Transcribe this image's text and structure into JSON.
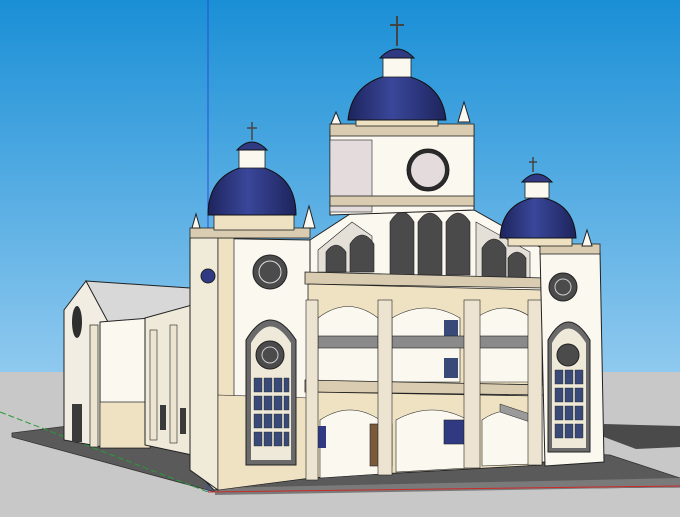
{
  "scene": {
    "sky_color_top": "#1a8fd6",
    "sky_color_bottom": "#8fc9ef",
    "ground_color": "#c8c8c8",
    "base_slab_color": "#5a5a5a",
    "wall_color": "#fbf8f0",
    "cream_color": "#efe2c2",
    "trim_color": "#d9ccb0",
    "dome_color": "#2f3a83",
    "dome_shadow": "#1d245c",
    "window_color": "#3a4a78",
    "door_color": "#7a5a3a",
    "axis_blue": "#2a4dd8",
    "axis_green": "#2a9a3a",
    "axis_red": "#cc2a2a",
    "outline_color": "#222222"
  }
}
